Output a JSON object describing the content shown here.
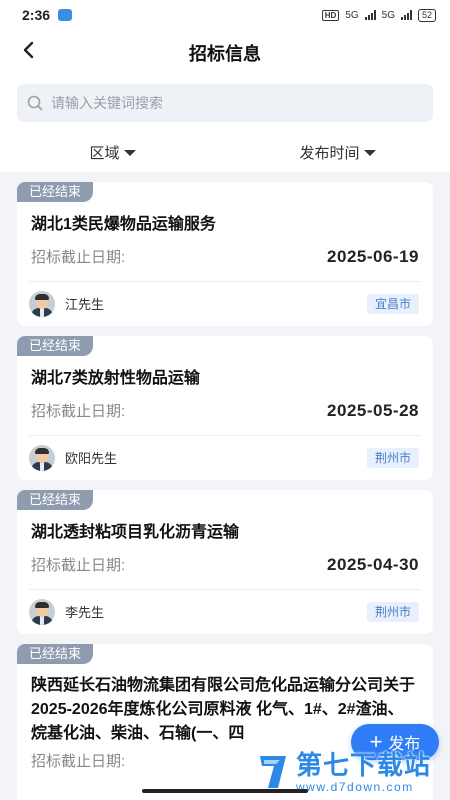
{
  "status_bar": {
    "time": "2:36",
    "hd": "HD",
    "net1": "5G",
    "net2": "5G",
    "battery": "52"
  },
  "header": {
    "title": "招标信息",
    "back_icon": "chevron-left-icon"
  },
  "search": {
    "placeholder": "请输入关键词搜索",
    "value": ""
  },
  "filters": [
    {
      "label": "区域",
      "icon": "caret-down-icon"
    },
    {
      "label": "发布时间",
      "icon": "caret-down-icon"
    }
  ],
  "cards": [
    {
      "status": "已经结束",
      "title": "湖北1类民爆物品运输服务",
      "deadline_label": "招标截止日期:",
      "deadline": "2025-06-19",
      "user": "江先生",
      "city": "宜昌市"
    },
    {
      "status": "已经结束",
      "title": "湖北7类放射性物品运输",
      "deadline_label": "招标截止日期:",
      "deadline": "2025-05-28",
      "user": "欧阳先生",
      "city": "荆州市"
    },
    {
      "status": "已经结束",
      "title": "湖北透封粘项目乳化沥青运输",
      "deadline_label": "招标截止日期:",
      "deadline": "2025-04-30",
      "user": "李先生",
      "city": "荆州市"
    },
    {
      "status": "已经结束",
      "title": "陕西延长石油物流集团有限公司危化品运输分公司关于2025-2026年度炼化公司原料液 化气、1#、2#渣油、烷基化油、柴油、石输(一、四",
      "deadline_label": "招标截止日期:"
    }
  ],
  "fab": {
    "label": "发布",
    "icon": "plus-icon"
  },
  "watermark": {
    "name": "第七下载站",
    "url": "www.d7down.com"
  },
  "colors": {
    "primary": "#2f7df6",
    "badge": "#8f9cb0",
    "city_bg": "#e7f0fc",
    "city_text": "#4a7fc9"
  }
}
